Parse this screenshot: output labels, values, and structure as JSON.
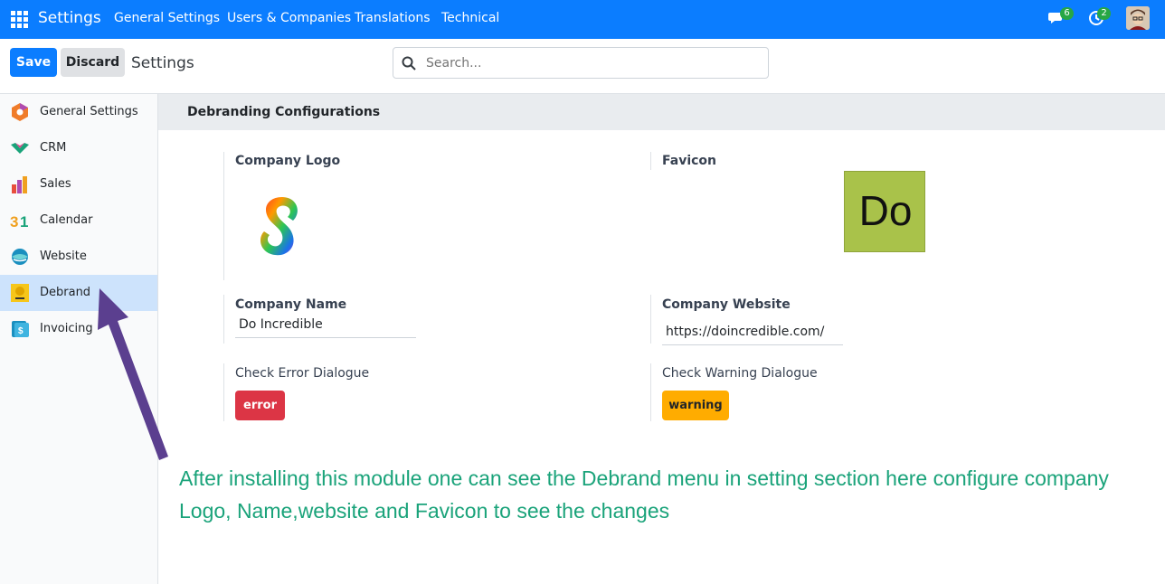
{
  "topbar": {
    "brand": "Settings",
    "menu": [
      "General Settings",
      "Users & Companies",
      "Translations",
      "Technical"
    ],
    "messages_count": "6",
    "activities_count": "2",
    "color": "#0b7dff"
  },
  "controlbar": {
    "save_label": "Save",
    "discard_label": "Discard",
    "title": "Settings",
    "search_placeholder": "Search..."
  },
  "sidebar": {
    "items": [
      {
        "label": "General Settings",
        "icon": "settings-hexagon-icon"
      },
      {
        "label": "CRM",
        "icon": "crm-handshake-icon"
      },
      {
        "label": "Sales",
        "icon": "sales-chart-icon"
      },
      {
        "label": "Calendar",
        "icon": "calendar-31-icon"
      },
      {
        "label": "Website",
        "icon": "website-globe-icon"
      },
      {
        "label": "Debrand",
        "icon": "debrand-icon",
        "active": true
      },
      {
        "label": "Invoicing",
        "icon": "invoicing-dollar-icon"
      }
    ]
  },
  "section": {
    "title": "Debranding Configurations"
  },
  "settings": {
    "company_logo_label": "Company Logo",
    "favicon_label": "Favicon",
    "favicon_text": "Do",
    "company_name_label": "Company Name",
    "company_name_value": "Do Incredible",
    "company_website_label": "Company Website",
    "company_website_value": "https://doincredible.com/",
    "error_dialog_label": "Check Error Dialogue",
    "error_button": "error",
    "warning_dialog_label": "Check Warning Dialogue",
    "warning_button": "warning"
  },
  "annotation": {
    "text": "After installing this module one can see the Debrand menu in setting section here configure company Logo, Name,website and Favicon to see the changes"
  }
}
